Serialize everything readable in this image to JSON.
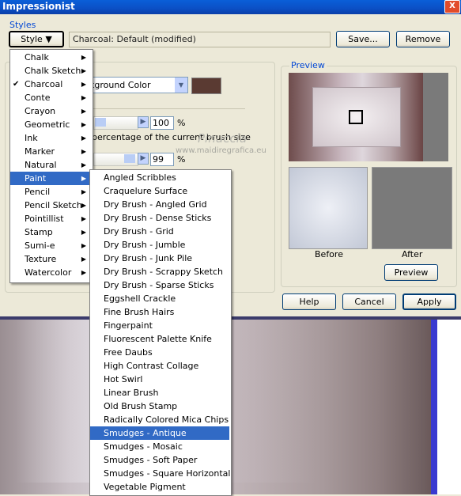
{
  "window": {
    "title": "Impressionist",
    "close_glyph": "X"
  },
  "styles": {
    "group_label": "Styles",
    "style_button": "Style",
    "current_style": "Charcoal: Default (modified)",
    "save_label": "Save...",
    "remove_label": "Remove"
  },
  "params": {
    "dropdown_value": "kground Color",
    "swatch_color": "#5a3a32",
    "size_value": "100",
    "size_unit": "%",
    "size_desc": "percentage of the current brush size",
    "second_value": "99",
    "second_unit": "%"
  },
  "preview": {
    "group_label": "Preview",
    "before_label": "Before",
    "after_label": "After",
    "preview_button": "Preview"
  },
  "footer": {
    "help": "Help",
    "cancel": "Cancel",
    "apply": "Apply"
  },
  "watermark": {
    "line1": "Pinuccia",
    "line2": "www.maidiregrafica.eu"
  },
  "style_menu": [
    {
      "label": "Chalk",
      "checked": false,
      "selected": false
    },
    {
      "label": "Chalk Sketch",
      "checked": false,
      "selected": false
    },
    {
      "label": "Charcoal",
      "checked": true,
      "selected": false
    },
    {
      "label": "Conte",
      "checked": false,
      "selected": false
    },
    {
      "label": "Crayon",
      "checked": false,
      "selected": false
    },
    {
      "label": "Geometric",
      "checked": false,
      "selected": false
    },
    {
      "label": "Ink",
      "checked": false,
      "selected": false
    },
    {
      "label": "Marker",
      "checked": false,
      "selected": false
    },
    {
      "label": "Natural",
      "checked": false,
      "selected": false
    },
    {
      "label": "Paint",
      "checked": false,
      "selected": true
    },
    {
      "label": "Pencil",
      "checked": false,
      "selected": false
    },
    {
      "label": "Pencil Sketch",
      "checked": false,
      "selected": false
    },
    {
      "label": "Pointillist",
      "checked": false,
      "selected": false
    },
    {
      "label": "Stamp",
      "checked": false,
      "selected": false
    },
    {
      "label": "Sumi-e",
      "checked": false,
      "selected": false
    },
    {
      "label": "Texture",
      "checked": false,
      "selected": false
    },
    {
      "label": "Watercolor",
      "checked": false,
      "selected": false
    }
  ],
  "paint_menu": [
    {
      "label": "Angled Scribbles",
      "selected": false
    },
    {
      "label": "Craquelure Surface",
      "selected": false
    },
    {
      "label": "Dry Brush - Angled Grid",
      "selected": false
    },
    {
      "label": "Dry Brush - Dense Sticks",
      "selected": false
    },
    {
      "label": "Dry Brush - Grid",
      "selected": false
    },
    {
      "label": "Dry Brush - Jumble",
      "selected": false
    },
    {
      "label": "Dry Brush - Junk Pile",
      "selected": false
    },
    {
      "label": "Dry Brush - Scrappy Sketch",
      "selected": false
    },
    {
      "label": "Dry Brush - Sparse Sticks",
      "selected": false
    },
    {
      "label": "Eggshell Crackle",
      "selected": false
    },
    {
      "label": "Fine Brush Hairs",
      "selected": false
    },
    {
      "label": "Fingerpaint",
      "selected": false
    },
    {
      "label": "Fluorescent Palette Knife",
      "selected": false
    },
    {
      "label": "Free Daubs",
      "selected": false
    },
    {
      "label": "High Contrast Collage",
      "selected": false
    },
    {
      "label": "Hot Swirl",
      "selected": false
    },
    {
      "label": "Linear Brush",
      "selected": false
    },
    {
      "label": "Old Brush Stamp",
      "selected": false
    },
    {
      "label": "Radically Colored Mica Chips",
      "selected": false
    },
    {
      "label": "Smudges - Antique",
      "selected": true
    },
    {
      "label": "Smudges - Mosaic",
      "selected": false
    },
    {
      "label": "Smudges - Soft Paper",
      "selected": false
    },
    {
      "label": "Smudges - Square Horizontal",
      "selected": false
    },
    {
      "label": "Vegetable Pigment",
      "selected": false
    }
  ]
}
